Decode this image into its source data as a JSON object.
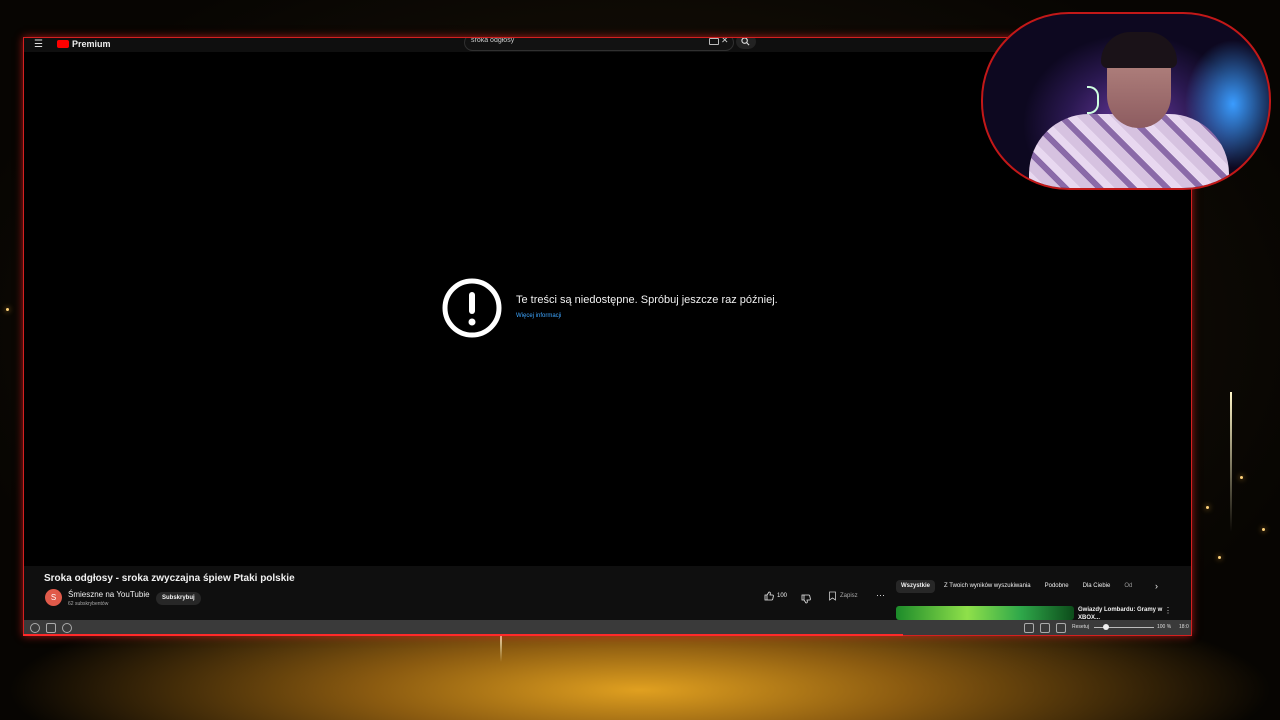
{
  "browser": {
    "logo_text": "Premium",
    "search_query": "sroka odgłosy"
  },
  "error": {
    "message": "Te treści są niedostępne. Spróbuj jeszcze raz później.",
    "link": "Więcej informacji"
  },
  "video": {
    "title": "Sroka odgłosy - sroka zwyczajna śpiew Ptaki polskie",
    "channel_initial": "S",
    "channel_name": "Śmieszne na YouTubie",
    "subscribers": "62 subskrybentów",
    "subscribe_label": "Subskrybuj",
    "like_count": "100",
    "save_label": "Zapisz"
  },
  "recommendations": {
    "chips": [
      "Wszystkie",
      "Z Twoich wyników wyszukiwania",
      "Podobne",
      "Dla Ciebie",
      "Od"
    ],
    "first_title": "Gwiazdy Lombardu: Gramy w XBOX..."
  },
  "statusbar": {
    "reset_label": "Resetuj",
    "zoom": "100 %",
    "extra": "18:0"
  },
  "colors": {
    "frame_border": "#d42020",
    "link": "#3ea6ff",
    "accent_gold": "#e0a020"
  }
}
